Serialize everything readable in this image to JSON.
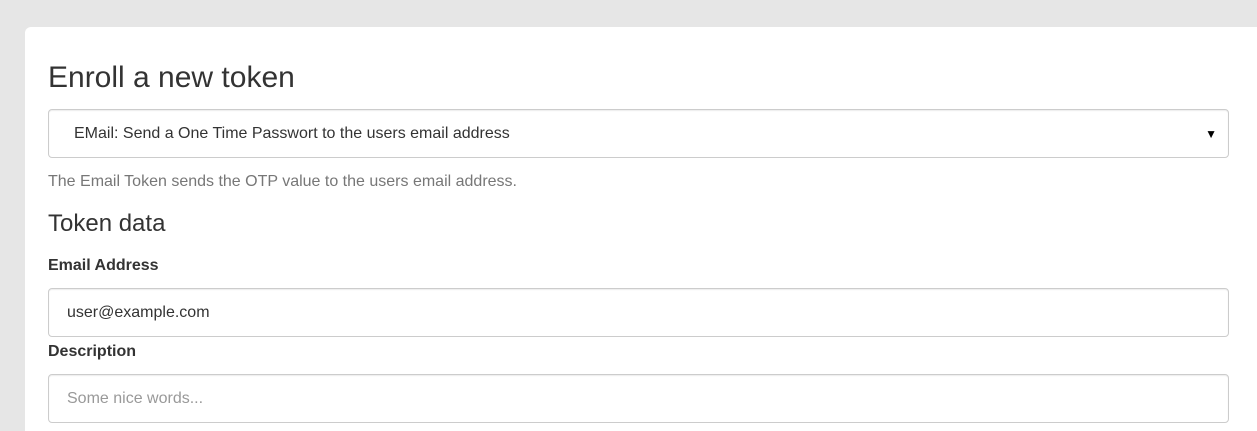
{
  "page": {
    "title": "Enroll a new token"
  },
  "token_type_select": {
    "selected": "EMail: Send a One Time Passwort to the users email address",
    "arrow_icon": "triangle-down-icon"
  },
  "token_type_help": "The Email Token sends the OTP value to the users email address.",
  "token_data": {
    "heading": "Token data",
    "email": {
      "label": "Email Address",
      "value": "user@example.com"
    },
    "description": {
      "label": "Description",
      "value": "",
      "placeholder": "Some nice words..."
    }
  },
  "colors": {
    "background": "#e6e6e6",
    "card": "#ffffff",
    "text": "#333333",
    "muted": "#777777",
    "border": "#cccccc",
    "placeholder": "#999999"
  }
}
